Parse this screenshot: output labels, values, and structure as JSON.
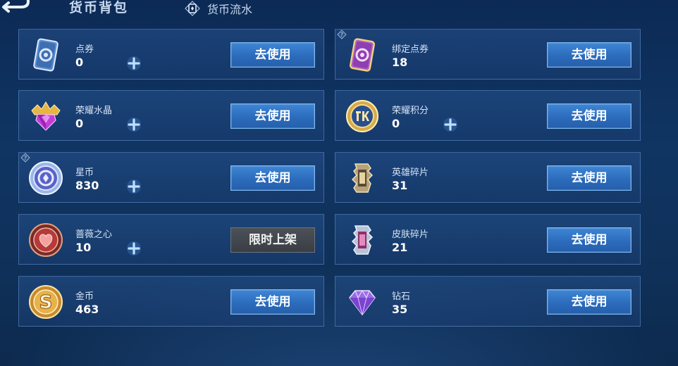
{
  "header": {
    "title": "货币背包",
    "flow_tab_label": "货币流水"
  },
  "currencies": [
    {
      "name": "点券",
      "count": "0",
      "button": "去使用"
    },
    {
      "name": "绑定点券",
      "count": "18",
      "button": "去使用"
    },
    {
      "name": "荣耀水晶",
      "count": "0",
      "button": "去使用"
    },
    {
      "name": "荣耀积分",
      "count": "0",
      "button": "去使用"
    },
    {
      "name": "星币",
      "count": "830",
      "button": "去使用"
    },
    {
      "name": "英雄碎片",
      "count": "31",
      "button": "去使用"
    },
    {
      "name": "蔷薇之心",
      "count": "10",
      "button": "限时上架"
    },
    {
      "name": "皮肤碎片",
      "count": "21",
      "button": "去使用"
    },
    {
      "name": "金币",
      "count": "463",
      "button": "去使用"
    },
    {
      "name": "钻石",
      "count": "35",
      "button": "去使用"
    }
  ],
  "colors": {
    "background": "#103563",
    "card_border": "#6ea0dc",
    "button_blue": "#2c6cbc",
    "button_disabled": "#3a3e44"
  },
  "icons": {
    "coupon": "blue-coupon-card-icon",
    "bound_coupon": "purple-coupon-card-icon",
    "crystal": "glory-crystal-icon",
    "points": "glory-points-coin-icon",
    "star": "star-coin-icon",
    "hero": "hero-fragment-icon",
    "rose": "rose-heart-icon",
    "skin": "skin-fragment-icon",
    "gold": "gold-coin-icon",
    "diamond": "diamond-icon"
  }
}
